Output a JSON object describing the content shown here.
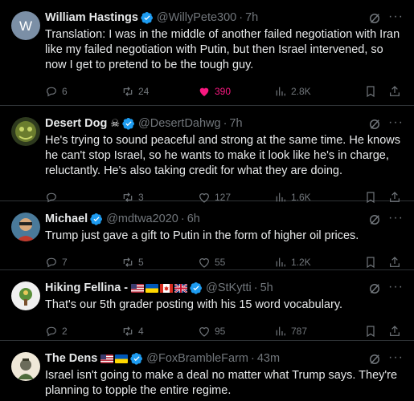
{
  "tweets": [
    {
      "name": "William Hastings",
      "handle": "@WillyPete300",
      "time": "7h",
      "verified": true,
      "text": "Translation:  I was in the middle of another failed negotiation with Iran like my failed negotiation with Putin, but then Israel intervened, so now I get to pretend to be the tough guy.",
      "replies": "6",
      "reposts": "24",
      "likes": "390",
      "views": "2.8K",
      "liked": true
    },
    {
      "name": "Desert Dog",
      "handle": "@DesertDahwg",
      "time": "7h",
      "verified": true,
      "text": "He's trying to sound peaceful and strong at the same time. He knows he can't stop Israel, so he wants to make it look like he's in charge, reluctantly. He's also taking credit for what they are doing.",
      "replies": "",
      "reposts": "3",
      "likes": "127",
      "views": "1.6K",
      "liked": false
    },
    {
      "name": "Michael",
      "handle": "@mdtwa2020",
      "time": "6h",
      "verified": true,
      "text": "Trump just gave a gift to Putin in the form of higher oil prices.",
      "replies": "7",
      "reposts": "5",
      "likes": "55",
      "views": "1.2K",
      "liked": false
    },
    {
      "name": "Hiking Fellina -",
      "handle": "@StKytti",
      "time": "5h",
      "verified": true,
      "text": "That's our 5th grader posting with his 15 word vocabulary.",
      "replies": "2",
      "reposts": "4",
      "likes": "95",
      "views": "787",
      "liked": false
    },
    {
      "name": "The Dens",
      "handle": "@FoxBrambleFarm",
      "time": "43m",
      "verified": true,
      "text": "Israel isn't going to make a deal no matter what Trump says. They're planning to topple the entire regime.",
      "replies": "",
      "reposts": "",
      "likes": "",
      "views": "",
      "liked": false
    }
  ],
  "separator": "·",
  "avatar_initial": "W",
  "colors": {
    "accent": "#1d9bf0",
    "like": "#f91880",
    "muted": "#71767b",
    "text": "#e7e9ea",
    "border": "#2f3336"
  },
  "icons": [
    "verified-icon",
    "grok-icon",
    "more-icon",
    "reply-icon",
    "repost-icon",
    "like-icon",
    "views-icon",
    "bookmark-icon",
    "share-icon",
    "skull-icon",
    "flag-icon"
  ]
}
